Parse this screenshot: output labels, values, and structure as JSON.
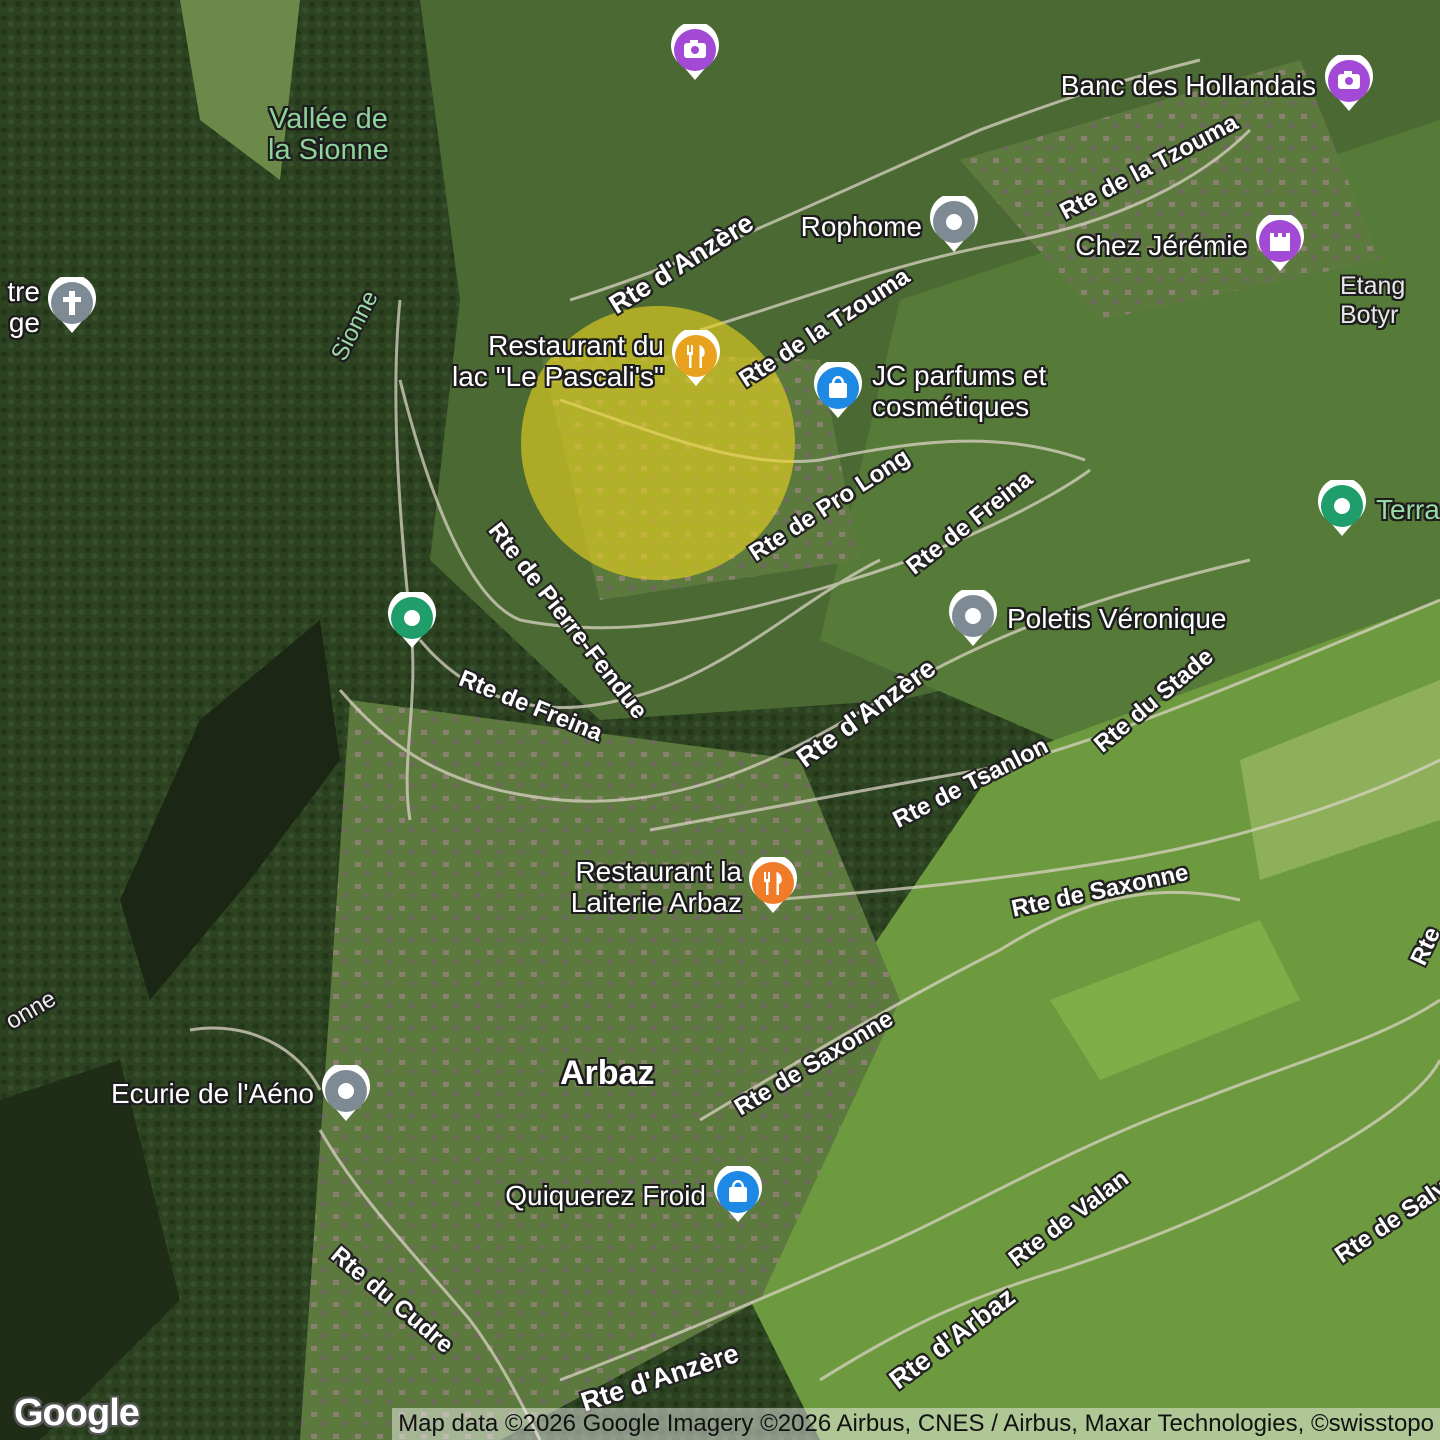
{
  "map": {
    "imagery": "satellite",
    "highlight_circle_color": "#e8d21f"
  },
  "region_labels": {
    "vallee": "Vallée de\nla Sionne",
    "sionne_top": "Sionne",
    "sionne_left": "onne",
    "etang": "Etang\nBotyr",
    "town": "Arbaz"
  },
  "pois": [
    {
      "id": "photo-top",
      "label": "",
      "category": "viewpoint",
      "icon": "camera-icon",
      "color": "#a24ad6"
    },
    {
      "id": "banc",
      "label": "Banc des Hollandais",
      "category": "viewpoint",
      "icon": "camera-icon",
      "color": "#a24ad6"
    },
    {
      "id": "rophome",
      "label": "Rophome",
      "category": "place",
      "icon": "place-dot-icon",
      "color": "#7e8b94"
    },
    {
      "id": "jeremie",
      "label": "Chez Jérémie",
      "category": "attraction",
      "icon": "castle-icon",
      "color": "#a24ad6"
    },
    {
      "id": "chapelle",
      "label": "tre\nge",
      "category": "church",
      "icon": "cross-icon",
      "color": "#7e8b94"
    },
    {
      "id": "pascali",
      "label": "Restaurant du\nlac \"Le Pascali's\"",
      "category": "restaurant",
      "icon": "fork-knife-icon",
      "color": "#e9a21e"
    },
    {
      "id": "jcparfums",
      "label": "JC parfums et\ncosmétiques",
      "category": "shop",
      "icon": "shopping-bag-icon",
      "color": "#1e88e5"
    },
    {
      "id": "terra",
      "label": "Terra",
      "category": "park",
      "icon": "place-dot-icon",
      "color": "#1f9d6b"
    },
    {
      "id": "sionne-green",
      "label": "",
      "category": "park",
      "icon": "place-dot-icon",
      "color": "#1f9d6b"
    },
    {
      "id": "poletis",
      "label": "Poletis Véronique",
      "category": "place",
      "icon": "place-dot-icon",
      "color": "#7e8b94"
    },
    {
      "id": "laiterie",
      "label": "Restaurant la\nLaiterie Arbaz",
      "category": "restaurant",
      "icon": "fork-knife-icon",
      "color": "#f07b28"
    },
    {
      "id": "ecurie",
      "label": "Ecurie de l'Aéno",
      "category": "place",
      "icon": "place-dot-icon",
      "color": "#7e8b94"
    },
    {
      "id": "quiquerez",
      "label": "Quiquerez Froid",
      "category": "shop",
      "icon": "shopping-bag-icon",
      "color": "#1e88e5"
    }
  ],
  "roads": [
    {
      "id": "anzere-top",
      "label": "Rte d'Anzère"
    },
    {
      "id": "tzouma-top",
      "label": "Rte de la Tzouma"
    },
    {
      "id": "tzouma-mid",
      "label": "Rte de la Tzouma"
    },
    {
      "id": "pierre",
      "label": "Rte de Pierre-Fendue"
    },
    {
      "id": "prolong",
      "label": "Rte de Pro Long"
    },
    {
      "id": "freina-r",
      "label": "Rte de Freina"
    },
    {
      "id": "freina-l",
      "label": "Rte de Freina"
    },
    {
      "id": "anzere-mid",
      "label": "Rte d'Anzère"
    },
    {
      "id": "stade",
      "label": "Rte du Stade"
    },
    {
      "id": "tsanlon",
      "label": "Rte de Tsanlon"
    },
    {
      "id": "saxonne-r",
      "label": "Rte de Saxonne"
    },
    {
      "id": "saxonne-c",
      "label": "Rte de Saxonne"
    },
    {
      "id": "cudre",
      "label": "Rte du Cudre"
    },
    {
      "id": "valan",
      "label": "Rte de Valan"
    },
    {
      "id": "arbaz",
      "label": "Rte d'Arbaz"
    },
    {
      "id": "anzere-bot",
      "label": "Rte d'Anzère"
    },
    {
      "id": "salv",
      "label": "Rte de Salv"
    },
    {
      "id": "rte-edge",
      "label": "Rte"
    }
  ],
  "footer": {
    "logo": "Google",
    "attribution": "Map data ©2026 Google Imagery ©2026 Airbus, CNES / Airbus, Maxar Technologies, ©swisstopo"
  }
}
